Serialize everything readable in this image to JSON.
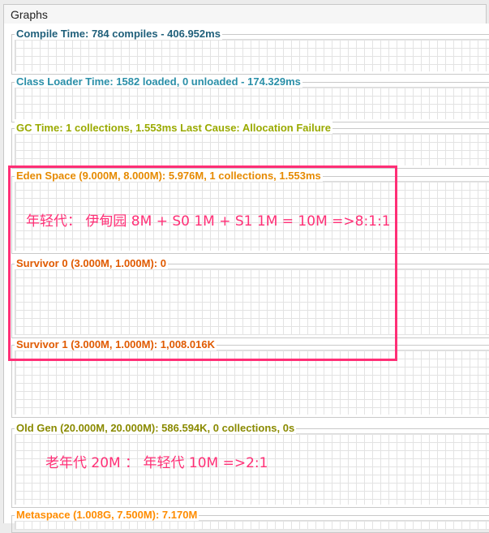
{
  "window": {
    "tab_label": "Graphs"
  },
  "colors": {
    "compile": "#1f5f7a",
    "classloader": "#2a8fa8",
    "gc": "#9aaa00",
    "eden": "#e68a00",
    "survivor": "#e05a00",
    "oldgen": "#8a8a00",
    "metaspace": "#ff8c00",
    "highlight": "#ff2f76"
  },
  "panels": [
    {
      "id": "compile",
      "title": "Compile Time: 784 compiles - 406.952ms"
    },
    {
      "id": "classloader",
      "title": "Class Loader Time: 1582 loaded, 0 unloaded - 174.329ms"
    },
    {
      "id": "gc",
      "title": "GC Time: 1 collections, 1.553ms Last Cause: Allocation Failure"
    },
    {
      "id": "eden",
      "title": "Eden Space (9.000M, 8.000M): 5.976M, 1 collections, 1.553ms"
    },
    {
      "id": "survivor0",
      "title": "Survivor 0 (3.000M, 1.000M): 0"
    },
    {
      "id": "survivor1",
      "title": "Survivor 1 (3.000M, 1.000M): 1,008.016K"
    },
    {
      "id": "oldgen",
      "title": "Old Gen (20.000M, 20.000M): 586.594K, 0 collections, 0s"
    },
    {
      "id": "metaspace",
      "title": "Metaspace (1.008G, 7.500M): 7.170M"
    }
  ],
  "annotations": {
    "young_gen": "年轻代：  伊甸园 8M + S0 1M + S1 1M = 10M   =>8:1:1",
    "old_gen": "老年代 20M  ：  年轻代 10M  =>2:1"
  }
}
